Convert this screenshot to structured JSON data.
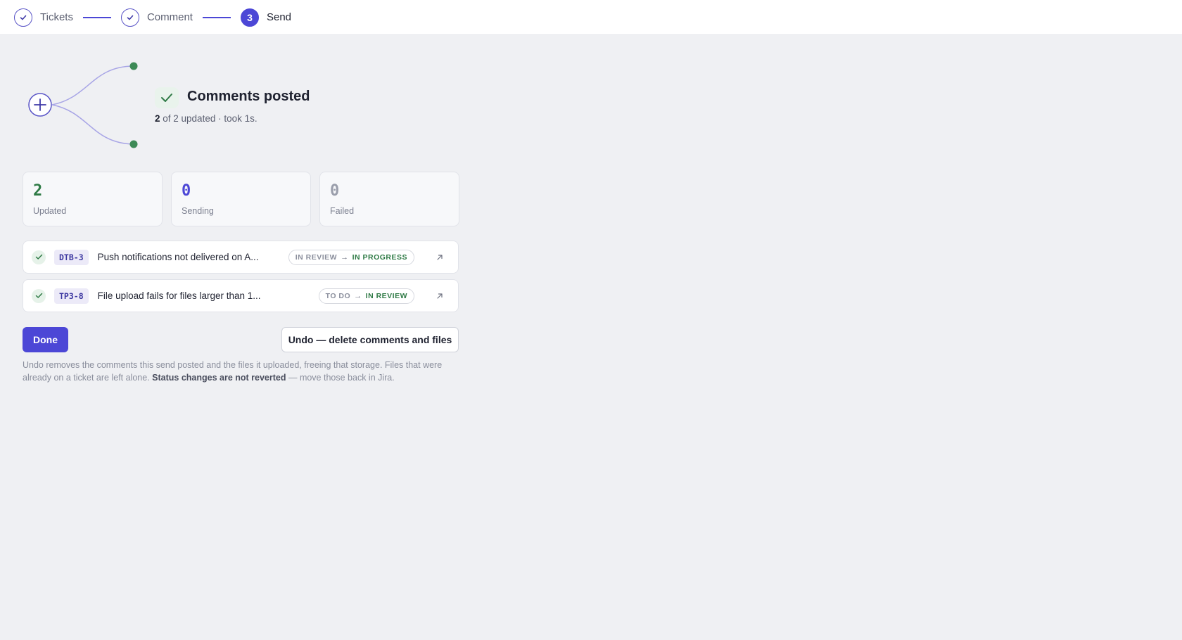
{
  "stepper": {
    "steps": [
      {
        "label": "Tickets",
        "state": "done"
      },
      {
        "label": "Comment",
        "state": "done"
      },
      {
        "label": "Send",
        "state": "active",
        "number": "3"
      }
    ]
  },
  "hero": {
    "title": "Comments posted",
    "updated_count": "2",
    "subtitle_rest": " of 2 updated · took 1s."
  },
  "stats": [
    {
      "value": "2",
      "label": "Updated",
      "color": "#2e7a45"
    },
    {
      "value": "0",
      "label": "Sending",
      "color": "#4c47d6"
    },
    {
      "value": "0",
      "label": "Failed",
      "color": "#9a9eab"
    }
  ],
  "tickets": [
    {
      "key": "DTB-3",
      "title": "Push notifications not delivered on A...",
      "from": "IN REVIEW",
      "to": "IN PROGRESS"
    },
    {
      "key": "TP3-8",
      "title": "File upload fails for files larger than 1...",
      "from": "TO DO",
      "to": "IN REVIEW"
    }
  ],
  "actions": {
    "done_label": "Done",
    "undo_label": "Undo — delete comments and files"
  },
  "note": {
    "part1": "Undo removes the comments this send posted and the files it uploaded, freeing that storage. Files that were already on a ticket are left alone. ",
    "bold": "Status changes are not reverted",
    "part2": " — move those back in Jira."
  },
  "colors": {
    "accent": "#4c47d6",
    "success": "#2e7a45",
    "background": "#eff0f3"
  }
}
